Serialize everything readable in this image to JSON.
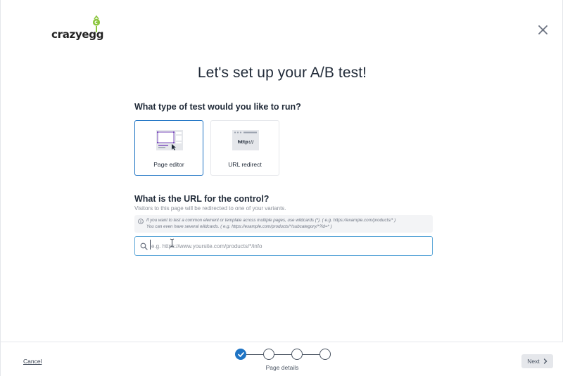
{
  "brand": {
    "name": "crazyegg",
    "accent": "#8cc63f"
  },
  "header": {
    "close_icon": "close-icon"
  },
  "page": {
    "title": "Let's set up your A/B test!"
  },
  "test_type": {
    "question": "What type of test would you like to run?",
    "options": [
      {
        "label": "Page editor",
        "selected": true,
        "icon": "page-editor-icon"
      },
      {
        "label": "URL redirect",
        "selected": false,
        "icon": "url-redirect-icon",
        "illustration_text": "http://"
      }
    ]
  },
  "control_url": {
    "question": "What is the URL for the control?",
    "subtitle": "Visitors to this page will be redirected to one of your variants.",
    "info_line1": "If you want to test a common element or template across multiple pages, use wildcards (*). ( e.g. https://example.com/products/* )",
    "info_line2": "You can even have several wildcards. ( e.g. https://example.com/products/*/subcategory/*?id=* )",
    "placeholder": "e.g. https://www.yoursite.com/products/*/info",
    "value": ""
  },
  "footer": {
    "cancel_label": "Cancel",
    "next_label": "Next",
    "steps": [
      {
        "state": "done"
      },
      {
        "state": "todo"
      },
      {
        "state": "todo"
      },
      {
        "state": "todo"
      }
    ],
    "current_step_label": "Page details"
  },
  "colors": {
    "primary": "#1f74c4",
    "input_border": "#5fa8d9",
    "info_bg": "#f3f4f6"
  }
}
